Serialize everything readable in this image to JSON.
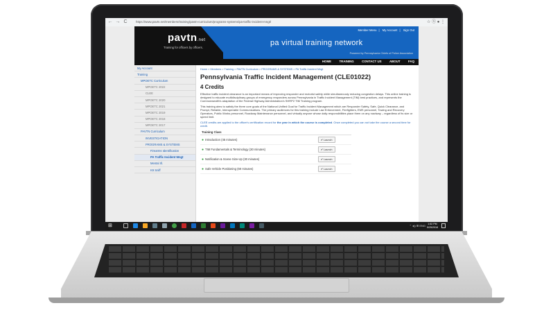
{
  "browser": {
    "back": "←",
    "forward": "→",
    "reload": "C",
    "url": "https://www.pavtn.net/members/training/pavtn-curriculum/programs-systems/pa-traffic-incident-mngt/",
    "icons": "☆  ⓢ  ●  ⋮"
  },
  "header": {
    "logo_main": "pavtn",
    "logo_net": ".net",
    "logo_sub": "Training for officers by officers.",
    "top_links": [
      "Member Menu",
      "My Account",
      "Sign Out"
    ],
    "site_title": "pa virtual training network",
    "powered_by": "Powered by Pennsylvania Chiefs of Police Association",
    "nav": [
      "HOME",
      "TRAINING",
      "CONTACT US",
      "ABOUT",
      "FAQ"
    ]
  },
  "sidebar": {
    "items": [
      "My Account",
      "Training",
      "MPOETC Curriculum",
      "MPOETC 2022",
      "CLEE",
      "MPOETC 2020",
      "MPOETC 2021",
      "MPOETC 2019",
      "MPOETC 2018",
      "MPOETC 2017",
      "PAVTN Curriculum",
      "INVESTIGATION",
      "PROGRAMS & SYSTEMS",
      "Firearms Identification",
      "PA Traffic Incident Mngt",
      "Mental Ill.",
      "K9 Sniff"
    ]
  },
  "content": {
    "breadcrumb": "Home > Members > Training > PAVTN Curriculum > PROGRAMS & SYSTEMS > PA Traffic Incident Mngt",
    "title": "Pennsylvania Traffic Incident Management (CLE01022)",
    "credits": "4 Credits",
    "para1": "Effective traffic incident clearance is an important means of improving responder and motorist safety while simultaneously reducing congestion delays. This online training is designed to educate multidisciplinary groups of emergency responders across Pennsylvania in Traffic Incident Management (TIM) best practices, and represents the Commonwealth's adaptation of the Federal Highway Administration's SHRP2 TIM Training program.",
    "para2": "This training aims to satisfy the three core goals of the National Unified Goal for Traffic Incident Management which are Responder Safety, Safe, Quick Clearance, and Prompt, Reliable, Interoperable Communications. The primary audiences for this training include Law Enforcement, Firefighters, EMS personnel, Towing and Recovery Operators, Public Works personnel, Roadway Maintenance personnel, and virtually anyone whose daily responsibilities place them on any roadway – regardless of its size or speed limit.",
    "credits_note_pre": "CLEE credits are applied to the officer's certification record for ",
    "credits_note_bold": "the year in which the course is completed",
    "credits_note_post": ". Once completed you can not take the course a second time for credit.",
    "table_header": "Training Class",
    "launch_label": "✔ Launch",
    "classes": [
      "Introduction (45 minutes)",
      "TIM Fundamentals & Terminology (30 minutes)",
      "Notification & Scene Size-Up (30 minutes)",
      "Safe Vehicle Positioning (60 minutes)"
    ]
  },
  "taskbar": {
    "time": "1:52 PM",
    "date": "5/25/2018",
    "tray": "⌃ ◂)) ⊞ ENG"
  },
  "colors": {
    "header_blue": "#1565c0",
    "header_black": "#111111",
    "link_blue": "#1a5fb4",
    "status_green": "#2e9d3b"
  }
}
